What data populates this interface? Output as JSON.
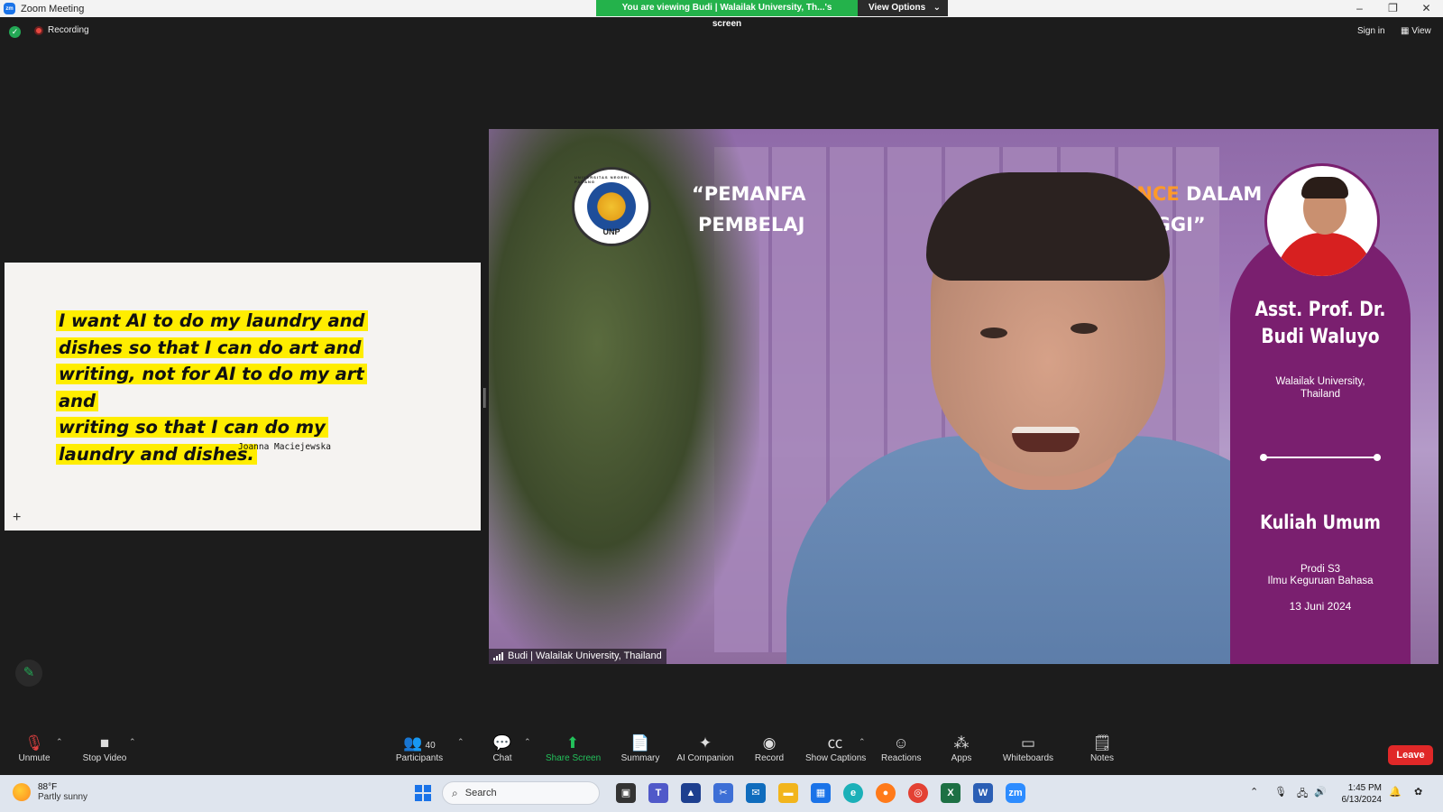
{
  "window": {
    "title": "Zoom Meeting",
    "logo_text": "zm",
    "banner_text": "You are viewing Budi | Walailak University, Th...'s screen",
    "view_options_label": "View Options"
  },
  "topbar": {
    "recording_label": "Recording",
    "sign_in_label": "Sign in",
    "view_label": "View"
  },
  "slide": {
    "quote_lines": [
      "I want AI to do my laundry and",
      "dishes so that I can do art and",
      "writing, not for AI to do my art and",
      "writing so that I can do my",
      "laundry and dishes."
    ],
    "author": "Joanna Maciejewska"
  },
  "video": {
    "title_line1_a": "“PEMANFA",
    "title_line1_b": "CIAL INTELLIGENCE",
    "title_line1_c": "DALAM",
    "title_line2_a": "PEMBELAJ",
    "title_line2_b": "PERGURUAN TINGGI”",
    "logo_arc_text": "UNIVERSITAS NEGERI PADANG",
    "logo_text": "UNP",
    "speaker_name_line1": "Asst. Prof. Dr.",
    "speaker_name_line2": "Budi Waluyo",
    "affiliation_line1": "Walailak University,",
    "affiliation_line2": "Thailand",
    "event_title": "Kuliah Umum",
    "program_line1": "Prodi S3",
    "program_line2": "Ilmu Keguruan Bahasa",
    "date": "13 Juni 2024",
    "participant_label": "Budi | Walailak University, Thailand"
  },
  "toolbar": {
    "unmute": "Unmute",
    "stop_video": "Stop Video",
    "participants": "Participants",
    "participant_count": "40",
    "chat": "Chat",
    "share_screen": "Share Screen",
    "summary": "Summary",
    "ai_companion": "AI Companion",
    "record": "Record",
    "show_captions": "Show Captions",
    "reactions": "Reactions",
    "apps": "Apps",
    "whiteboards": "Whiteboards",
    "notes": "Notes",
    "leave": "Leave",
    "share_color": "#23c15b",
    "leave_color": "#e02828"
  },
  "taskbar": {
    "temperature": "88°F",
    "weather": "Partly sunny",
    "search_placeholder": "Search",
    "time": "1:45 PM",
    "date": "6/13/2024",
    "zoom_app_text": "zm",
    "excel_text": "X",
    "word_text": "W",
    "teams_text": "T"
  }
}
